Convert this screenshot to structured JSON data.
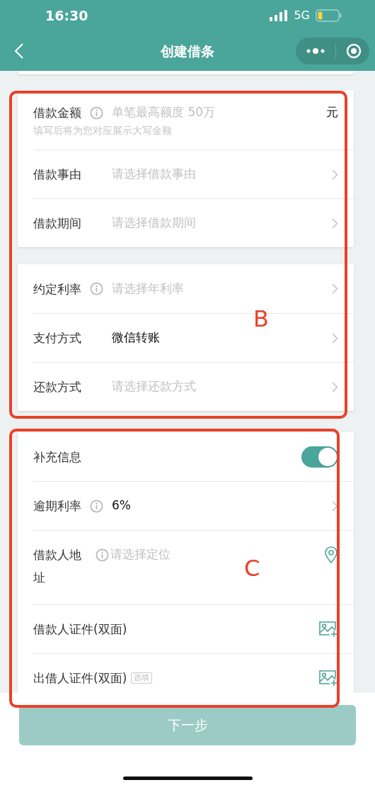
{
  "status_bar": {
    "time": "16:30",
    "network": "5G"
  },
  "nav": {
    "title": "创建借条"
  },
  "sections": [
    {
      "rows": [
        {
          "kind": "amount",
          "label": "借款金额",
          "info": true,
          "placeholder": "单笔最高额度 50万",
          "hint": "填写后将为您对应展示大写金额",
          "unit": "元"
        },
        {
          "kind": "select",
          "label": "借款事由",
          "placeholder": "请选择借款事由"
        },
        {
          "kind": "select",
          "label": "借款期间",
          "placeholder": "请选择借款期间"
        }
      ]
    },
    {
      "rows": [
        {
          "kind": "select",
          "label": "约定利率",
          "info": true,
          "placeholder": "请选择年利率"
        },
        {
          "kind": "select",
          "label": "支付方式",
          "value": "微信转账"
        },
        {
          "kind": "select",
          "label": "还款方式",
          "placeholder": "请选择还款方式"
        }
      ]
    },
    {
      "rows": [
        {
          "kind": "toggle",
          "label": "补充信息",
          "on": true
        },
        {
          "kind": "select",
          "label": "逾期利率",
          "info": true,
          "value": "6%"
        },
        {
          "kind": "location",
          "label": "借款人地址",
          "info": true,
          "placeholder": "请选择定位"
        },
        {
          "kind": "upload",
          "label": "借款人证件(双面)"
        },
        {
          "kind": "upload",
          "label": "出借人证件(双面)",
          "tag": "选填"
        }
      ]
    }
  ],
  "next_button": {
    "label": "下一步",
    "disabled": true
  },
  "annotations": [
    {
      "label": "B"
    },
    {
      "label": "C"
    }
  ]
}
